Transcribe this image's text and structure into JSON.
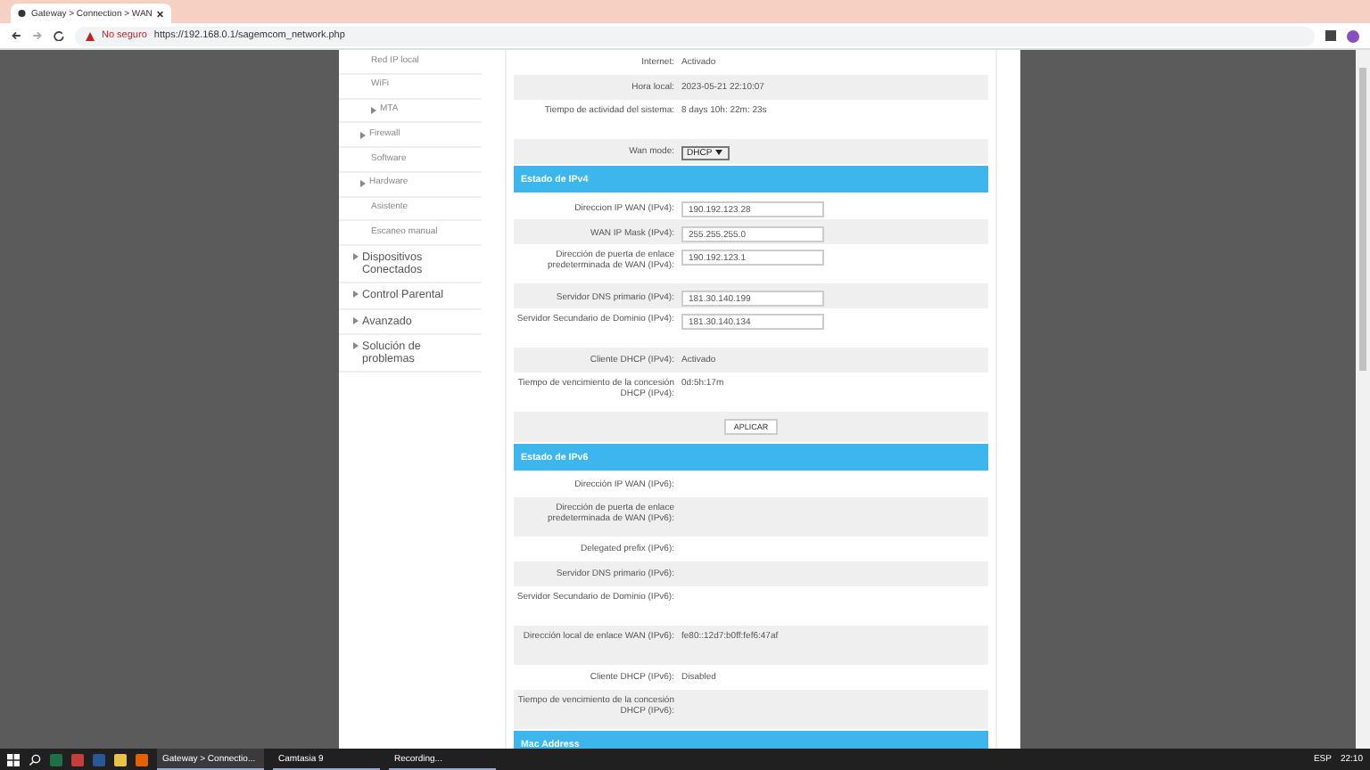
{
  "browser": {
    "tab_title": "Gateway > Connection > WAN",
    "not_secure": "No seguro",
    "url": "https://192.168.0.1/sagemcom_network.php"
  },
  "sidebar": {
    "items": [
      {
        "label": "Red IP local",
        "kind": "sub",
        "expandable": false
      },
      {
        "label": "WiFi",
        "kind": "sub",
        "expandable": false
      },
      {
        "label": "MTA",
        "kind": "sub",
        "expandable": true
      },
      {
        "label": "Firewall",
        "kind": "group",
        "expandable": true
      },
      {
        "label": "Software",
        "kind": "sub",
        "expandable": false
      },
      {
        "label": "Hardware",
        "kind": "group",
        "expandable": true
      },
      {
        "label": "Asistente",
        "kind": "sub",
        "expandable": false
      },
      {
        "label": "Escaneo manual",
        "kind": "sub",
        "expandable": false
      },
      {
        "label": "Dispositivos Conectados",
        "kind": "top",
        "expandable": true
      },
      {
        "label": "Control Parental",
        "kind": "top",
        "expandable": true
      },
      {
        "label": "Avanzado",
        "kind": "top",
        "expandable": true
      },
      {
        "label": "Solución de problemas",
        "kind": "top",
        "expandable": true
      }
    ]
  },
  "sections": [
    {
      "rows": [
        {
          "kind": "text",
          "label": "Internet:",
          "value": "Activado"
        },
        {
          "kind": "text",
          "label": "Hora local:",
          "value": "2023-05-21 22:10:07"
        },
        {
          "kind": "text",
          "label": "Tiempo de actividad del sistema:",
          "value": "8 days 10h: 22m: 23s"
        },
        {
          "kind": "select",
          "label": "Wan mode:",
          "value": "DHCP"
        }
      ]
    },
    {
      "title": "Estado de IPv4",
      "rows": [
        {
          "kind": "input",
          "label": "Direccion IP WAN (IPv4):",
          "value": "190.192.123.28"
        },
        {
          "kind": "input",
          "label": "WAN IP Mask (IPv4):",
          "value": "255.255.255.0"
        },
        {
          "kind": "input",
          "label": "Dirección de puerta de enlace predeterminada de WAN (IPv4):",
          "value": "190.192.123.1"
        },
        {
          "kind": "input",
          "label": "Servidor DNS primario (IPv4):",
          "value": "181.30.140.199"
        },
        {
          "kind": "input",
          "label": "Servidor Secundario de Dominio (IPv4):",
          "value": "181.30.140.134"
        },
        {
          "kind": "text",
          "label": "Cliente DHCP (IPv4):",
          "value": "Activado"
        },
        {
          "kind": "text",
          "label": "Tiempo de vencimiento de la concesión DHCP (IPv4):",
          "value": "0d:5h:17m"
        },
        {
          "kind": "button",
          "value": "APLICAR"
        }
      ]
    },
    {
      "title": "Estado de IPv6",
      "rows": [
        {
          "kind": "text",
          "label": "Dirección IP WAN (IPv6):"
        },
        {
          "kind": "text",
          "label": "Dirección de puerta de enlace predeterminada de WAN (IPv6):"
        },
        {
          "kind": "text",
          "label": "Delegated prefix (IPv6):"
        },
        {
          "kind": "text",
          "label": "Servidor DNS primario (IPv6):"
        },
        {
          "kind": "text",
          "label": "Servidor Secundario de Dominio (IPv6):"
        },
        {
          "kind": "text",
          "label": "Dirección local de enlace WAN (IPv6):",
          "value": "fe80::12d7:b0ff:fef6:47af"
        },
        {
          "kind": "text",
          "label": "Cliente DHCP (IPv6):",
          "value": "Disabled"
        },
        {
          "kind": "text",
          "label": "Tiempo de vencimiento de la concesión DHCP (IPv6):"
        }
      ]
    },
    {
      "title": "Mac Address"
    }
  ],
  "taskbar": {
    "windows": [
      {
        "label": "Gateway > Connectio...",
        "selected": true
      },
      {
        "label": "Camtasia 9",
        "selected": false
      },
      {
        "label": "Recording...",
        "selected": false
      }
    ],
    "language": "ESP",
    "time": "22:10"
  }
}
